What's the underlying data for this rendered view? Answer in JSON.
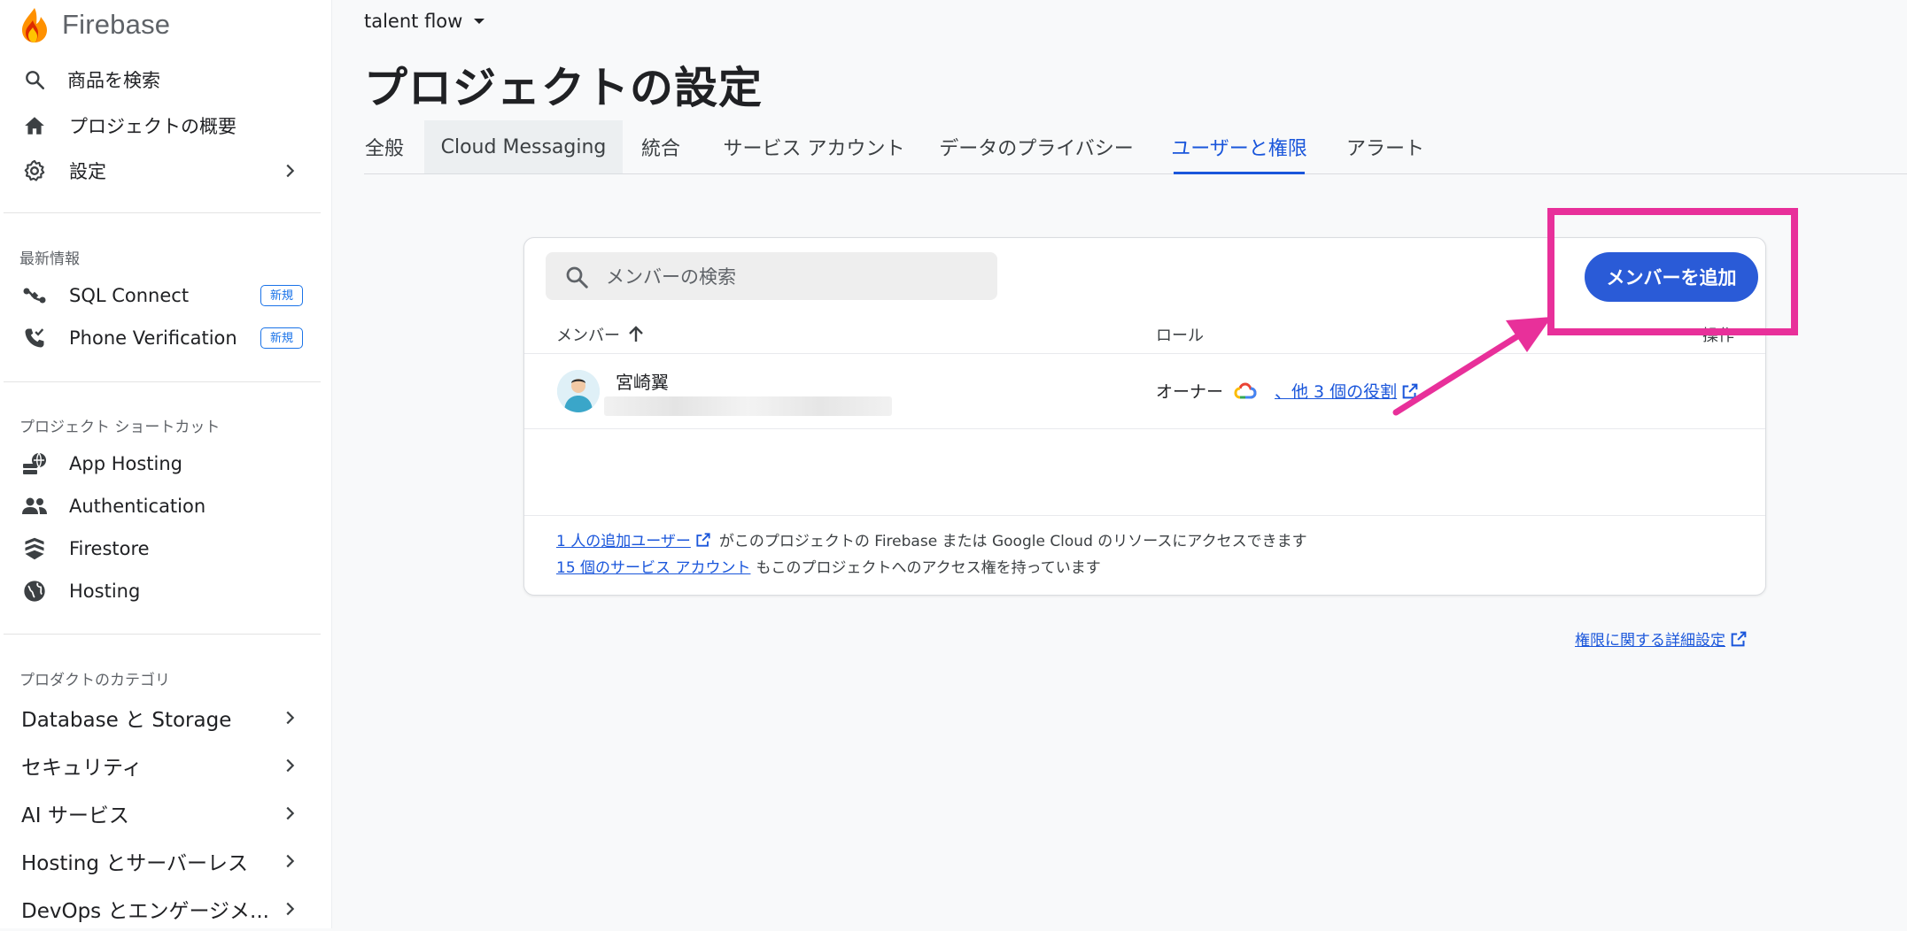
{
  "sidebar": {
    "brand": "Firebase",
    "top_items": [
      {
        "label": "商品を検索",
        "icon": "search-icon"
      },
      {
        "label": "プロジェクトの概要",
        "icon": "home-icon"
      },
      {
        "label": "設定",
        "icon": "gear-icon"
      }
    ],
    "whats_new": {
      "heading": "最新情報",
      "items": [
        {
          "label": "SQL Connect",
          "badge": "新規",
          "icon": "sql-connect-icon"
        },
        {
          "label": "Phone Verification",
          "badge": "新規",
          "icon": "phone-verification-icon"
        }
      ]
    },
    "shortcuts": {
      "heading": "プロジェクト ショートカット",
      "items": [
        {
          "label": "App Hosting",
          "icon": "app-hosting-icon"
        },
        {
          "label": "Authentication",
          "icon": "authentication-icon"
        },
        {
          "label": "Firestore",
          "icon": "firestore-icon"
        },
        {
          "label": "Hosting",
          "icon": "hosting-globe-icon"
        }
      ]
    },
    "categories": {
      "heading": "プロダクトのカテゴリ",
      "items": [
        {
          "label": "Database と Storage"
        },
        {
          "label": "セキュリティ"
        },
        {
          "label": "AI サービス"
        },
        {
          "label": "Hosting とサーバーレス"
        },
        {
          "label": "DevOps とエンゲージメ..."
        }
      ]
    }
  },
  "header": {
    "project": "talent flow",
    "title": "プロジェクトの設定"
  },
  "tabs": [
    {
      "label": "全般"
    },
    {
      "label": "Cloud Messaging"
    },
    {
      "label": "統合"
    },
    {
      "label": "サービス アカウント"
    },
    {
      "label": "データのプライバシー"
    },
    {
      "label": "ユーザーと権限"
    },
    {
      "label": "アラート"
    }
  ],
  "members": {
    "search_placeholder": "メンバーの検索",
    "add_button": "メンバーを追加",
    "columns": {
      "member": "メンバー",
      "role": "ロール",
      "actions": "操作"
    },
    "rows": [
      {
        "name": "宮崎翼",
        "role": "オーナー",
        "role_more": "、他 3 個の役割"
      }
    ],
    "footer": {
      "line1_link": "1 人の追加ユーザー",
      "line1_text": "がこのプロジェクトの Firebase または Google Cloud のリソースにアクセスできます",
      "line2_link": "15 個のサービス アカウント",
      "line2_text": "もこのプロジェクトへのアクセス権を持っています"
    }
  },
  "detail_link": "権限に関する詳細設定",
  "colors": {
    "accent": "#1a56db",
    "button": "#2a5bd7",
    "annotation": "#e8309a"
  }
}
